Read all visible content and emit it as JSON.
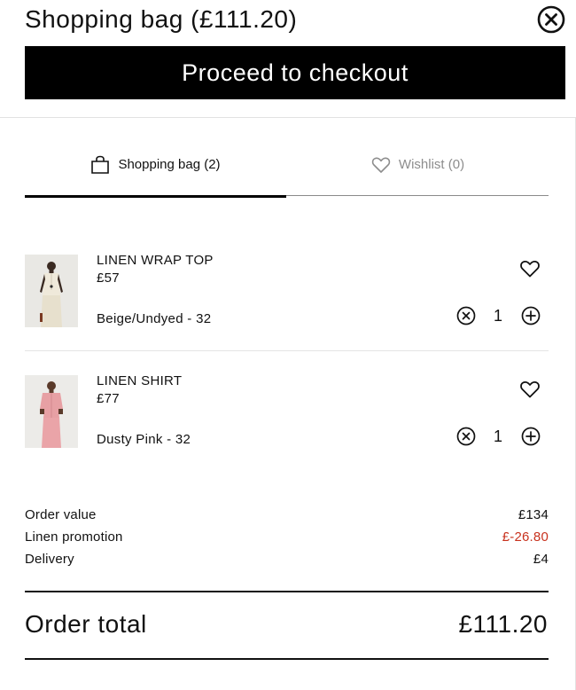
{
  "header": {
    "title": "Shopping bag (£111.20)",
    "close_icon": "close-circle-icon",
    "checkout_label": "Proceed to checkout",
    "checkout_bg": "#000000"
  },
  "tabs": [
    {
      "label": "Shopping bag (2)",
      "icon": "shopping-bag-icon",
      "active": true
    },
    {
      "label": "Wishlist (0)",
      "icon": "heart-icon",
      "active": false
    }
  ],
  "items": [
    {
      "name": "LINEN WRAP TOP",
      "price": "£57",
      "variant": "Beige/Undyed - 32",
      "quantity": "1"
    },
    {
      "name": "LINEN SHIRT",
      "price": "£77",
      "variant": "Dusty Pink - 32",
      "quantity": "1"
    }
  ],
  "summary": {
    "rows": [
      {
        "label": "Order value",
        "value": "£134"
      },
      {
        "label": "Linen promotion",
        "value": "£-26.80"
      },
      {
        "label": "Delivery",
        "value": "£4"
      }
    ],
    "promo_color": "#c8321e",
    "total_label": "Order total",
    "total_value": "£111.20"
  }
}
